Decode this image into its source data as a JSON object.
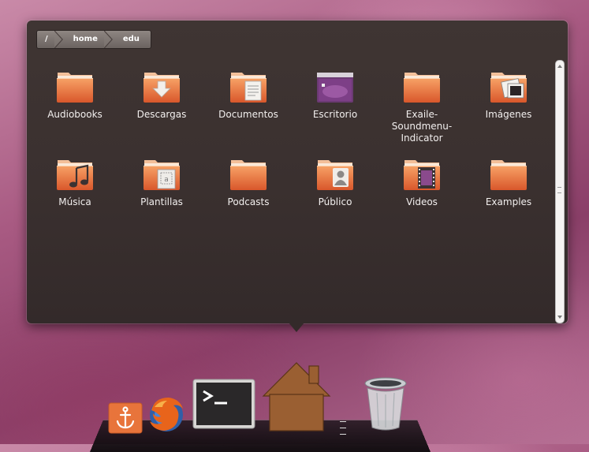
{
  "breadcrumb": {
    "segments": [
      {
        "label": "/"
      },
      {
        "label": "home"
      },
      {
        "label": "edu"
      }
    ]
  },
  "stack": {
    "items": [
      {
        "label": "Audiobooks",
        "icon": "folder-icon"
      },
      {
        "label": "Descargas",
        "icon": "downloads-folder-icon"
      },
      {
        "label": "Documentos",
        "icon": "documents-folder-icon"
      },
      {
        "label": "Escritorio",
        "icon": "desktop-folder-icon"
      },
      {
        "label": "Exaile-Soundmenu-Indicator",
        "icon": "folder-icon"
      },
      {
        "label": "Imágenes",
        "icon": "pictures-folder-icon"
      },
      {
        "label": "Música",
        "icon": "music-folder-icon"
      },
      {
        "label": "Plantillas",
        "icon": "templates-folder-icon"
      },
      {
        "label": "Podcasts",
        "icon": "folder-icon"
      },
      {
        "label": "Público",
        "icon": "public-folder-icon"
      },
      {
        "label": "Videos",
        "icon": "videos-folder-icon"
      },
      {
        "label": "Examples",
        "icon": "folder-icon"
      }
    ]
  },
  "dock": {
    "items": [
      {
        "icon": "anchor-icon"
      },
      {
        "icon": "firefox-icon"
      },
      {
        "icon": "terminal-icon"
      },
      {
        "icon": "home-folder-icon"
      },
      {
        "icon": "trash-icon"
      }
    ]
  },
  "colors": {
    "folder_orange": "#e8743b",
    "folder_light": "#f6a56a",
    "stack_bg": "#3a302f",
    "desktop_pink": "#a85a82"
  }
}
